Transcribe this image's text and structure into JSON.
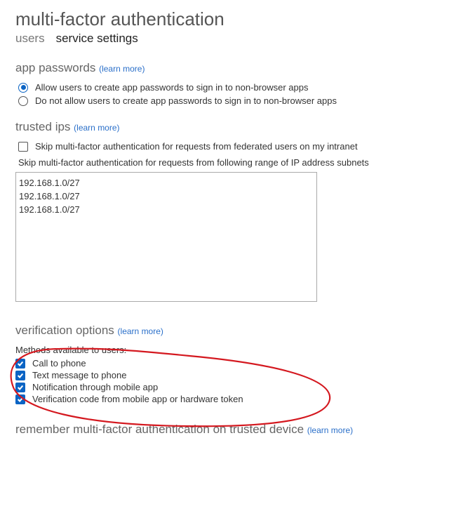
{
  "page_title": "multi-factor authentication",
  "tabs": {
    "users": "users",
    "service_settings": "service settings",
    "active": "service_settings"
  },
  "app_passwords": {
    "title": "app passwords",
    "learn_more": "learn more",
    "options": [
      {
        "label": "Allow users to create app passwords to sign in to non-browser apps",
        "selected": true
      },
      {
        "label": "Do not allow users to create app passwords to sign in to non-browser apps",
        "selected": false
      }
    ]
  },
  "trusted_ips": {
    "title": "trusted ips",
    "learn_more": "learn more",
    "skip_federated": {
      "label": "Skip multi-factor authentication for requests from federated users on my intranet",
      "checked": false
    },
    "subnets_label": "Skip multi-factor authentication for requests from following range of IP address subnets",
    "subnets_value": "192.168.1.0/27\n192.168.1.0/27\n192.168.1.0/27"
  },
  "verification_options": {
    "title": "verification options",
    "learn_more": "learn more",
    "methods_heading": "Methods available to users:",
    "methods": [
      {
        "label": "Call to phone",
        "checked": true
      },
      {
        "label": "Text message to phone",
        "checked": true
      },
      {
        "label": "Notification through mobile app",
        "checked": true
      },
      {
        "label": "Verification code from mobile app or hardware token",
        "checked": true
      }
    ]
  },
  "remember_mfa": {
    "title": "remember multi-factor authentication on trusted device",
    "learn_more": "learn more"
  }
}
